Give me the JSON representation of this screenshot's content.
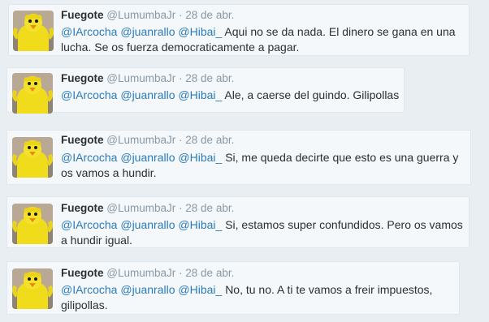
{
  "tweets": [
    {
      "author_name": "Fuegote",
      "author_handle": "@LumumbaJr",
      "separator": "·",
      "date": "28 de abr.",
      "mentions": [
        "@IArcocha",
        "@juanrallo",
        "@Hibai_"
      ],
      "text": "Aqui no se da nada. El dinero se gana en una lucha. Se os fuerza democraticamente a pagar."
    },
    {
      "author_name": "Fuegote",
      "author_handle": "@LumumbaJr",
      "separator": "·",
      "date": "28 de abr.",
      "mentions": [
        "@IArcocha",
        "@juanrallo",
        "@Hibai_"
      ],
      "text": "Ale, a caerse del guindo. Gilipollas"
    },
    {
      "author_name": "Fuegote",
      "author_handle": "@LumumbaJr",
      "separator": "·",
      "date": "28 de abr.",
      "mentions": [
        "@IArcocha",
        "@juanrallo",
        "@Hibai_"
      ],
      "text": "Si, me queda decirte que esto es una guerra y os vamos a hundir."
    },
    {
      "author_name": "Fuegote",
      "author_handle": "@LumumbaJr",
      "separator": "·",
      "date": "28 de abr.",
      "mentions": [
        "@IArcocha",
        "@juanrallo",
        "@Hibai_"
      ],
      "text": "Si, estamos super confundidos. Pero os vamos a hundir igual."
    },
    {
      "author_name": "Fuegote",
      "author_handle": "@LumumbaJr",
      "separator": "·",
      "date": "28 de abr.",
      "mentions": [
        "@IArcocha",
        "@juanrallo",
        "@Hibai_"
      ],
      "text": "No, tu no. A ti te vamos a freir impuestos, gilipollas."
    }
  ],
  "icons": {
    "avatar": "yellow-chicken-costume-avatar"
  },
  "colors": {
    "mention": "#2b7bb9",
    "name": "#292f33",
    "meta": "#8899a6",
    "card_background": "#f5f8fa"
  }
}
